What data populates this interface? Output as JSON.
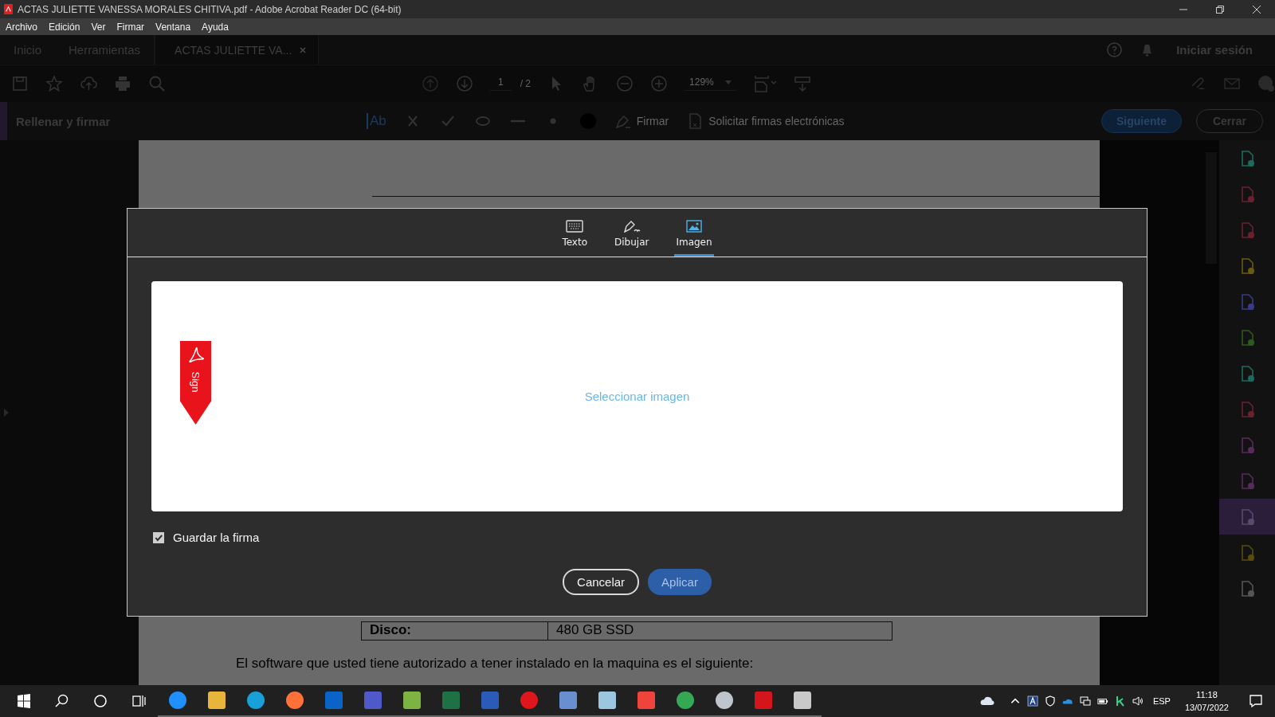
{
  "window": {
    "title": "ACTAS JULIETTE VANESSA MORALES CHITIVA.pdf - Adobe Acrobat Reader DC (64-bit)"
  },
  "menu": [
    "Archivo",
    "Edición",
    "Ver",
    "Firmar",
    "Ventana",
    "Ayuda"
  ],
  "tabs": [
    {
      "label": "Inicio",
      "selected": false
    },
    {
      "label": "Herramientas",
      "selected": false
    },
    {
      "label": "ACTAS JULIETTE VA...",
      "selected": true
    }
  ],
  "sign_in": "Iniciar sesión",
  "toolbar": {
    "page": "1",
    "page_total": "/ 2",
    "zoom": "129%"
  },
  "fill_sign": {
    "title": "Rellenar y firmar",
    "text_tool": "Ab",
    "sign": "Firmar",
    "request": "Solicitar firmas electrónicas",
    "next": "Siguiente",
    "close": "Cerrar"
  },
  "document": {
    "rows": [
      {
        "label": "Disco:",
        "value": "480 GB SSD"
      }
    ],
    "paragraph": "El software que usted tiene autorizado a tener instalado en la maquina es el siguiente:"
  },
  "dialog": {
    "tabs": [
      {
        "kind": "keyboard",
        "label": "Texto",
        "selected": false
      },
      {
        "kind": "pen",
        "label": "Dibujar",
        "selected": false
      },
      {
        "kind": "image",
        "label": "Imagen",
        "selected": true
      }
    ],
    "badge": "Sign",
    "select_image": "Seleccionar imagen",
    "save": {
      "label": "Guardar la firma",
      "checked": true
    },
    "cancel": "Cancelar",
    "apply": "Aplicar"
  },
  "tools": [
    {
      "color": "#1c6b5e",
      "selected": false
    },
    {
      "color": "#6b2030",
      "selected": false
    },
    {
      "color": "#6b2030",
      "selected": false
    },
    {
      "color": "#6b5a10",
      "selected": false
    },
    {
      "color": "#3a3a8a",
      "selected": false
    },
    {
      "color": "#2f5a1e",
      "selected": false
    },
    {
      "color": "#1c6b5e",
      "selected": false
    },
    {
      "color": "#6b2030",
      "selected": false
    },
    {
      "color": "#5a2a5e",
      "selected": false
    },
    {
      "color": "#5a2a5e",
      "selected": false
    },
    {
      "color": "#5a4a6e",
      "selected": true
    },
    {
      "color": "#5a4a10",
      "selected": false
    },
    {
      "color": "#555555",
      "selected": false
    }
  ],
  "taskbar": {
    "apps": [
      {
        "kind": "ie"
      },
      {
        "kind": "folder"
      },
      {
        "kind": "edge"
      },
      {
        "kind": "firefox"
      },
      {
        "kind": "outlook"
      },
      {
        "kind": "teams"
      },
      {
        "kind": "plant"
      },
      {
        "kind": "excel"
      },
      {
        "kind": "word"
      },
      {
        "kind": "opera"
      },
      {
        "kind": "monitor"
      },
      {
        "kind": "paper"
      },
      {
        "kind": "anydesk"
      },
      {
        "kind": "chrome"
      },
      {
        "kind": "globe"
      },
      {
        "kind": "acrobat"
      },
      {
        "kind": "paint"
      }
    ],
    "language": "ESP",
    "time": "11:18",
    "date": "13/07/2022"
  }
}
